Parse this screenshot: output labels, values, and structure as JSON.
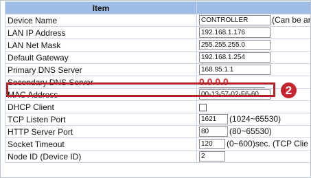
{
  "header": {
    "item_label": "Item",
    "value_label": ""
  },
  "rows": [
    {
      "label": "Device Name",
      "value": "CONTROLLER",
      "hint": "(Can be ar"
    },
    {
      "label": "LAN IP Address",
      "value": "192.168.1.176"
    },
    {
      "label": "LAN Net Mask",
      "value": "255.255.255.0"
    },
    {
      "label": "Default Gateway",
      "value": "192.168.1.254"
    },
    {
      "label": "Primary DNS Server",
      "value": "168.95.1.1"
    },
    {
      "label": "Secondary DNS Server",
      "value": "0.0.0.0"
    },
    {
      "label": "MAC Address",
      "value": "00-13-57-02-F6-60"
    },
    {
      "label": "DHCP Client",
      "checked": false
    },
    {
      "label": "TCP Listen Port",
      "value": "1621",
      "hint": "(1024~65530)"
    },
    {
      "label": "HTTP Server Port",
      "value": "80",
      "hint": "(80~65530)"
    },
    {
      "label": "Socket Timeout",
      "value": "120",
      "hint": "(0~600)sec. (TCP Clie"
    },
    {
      "label": "Node ID (Device ID)",
      "value": "2"
    }
  ],
  "annotation": {
    "step_number": "2",
    "color": "#c6262e"
  },
  "colors": {
    "header_bg": "#9fbee6",
    "highlight": "#b4232a",
    "dns_text": "#d7262f"
  }
}
